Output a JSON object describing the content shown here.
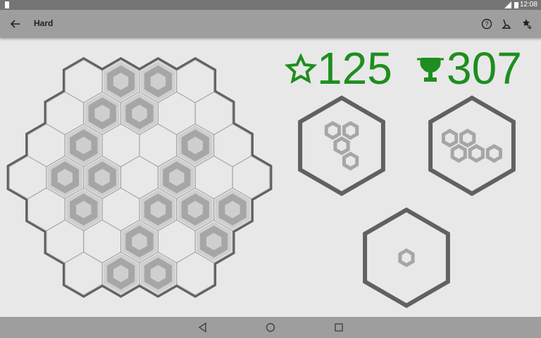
{
  "status_bar": {
    "time": "12:08"
  },
  "toolbar": {
    "title": "Hard",
    "back_icon": "arrow-back-icon",
    "actions": [
      "help-icon",
      "hint-icon",
      "leaderboard-icon"
    ]
  },
  "score": {
    "current": "125",
    "best": "307",
    "star_icon": "star-outline-icon",
    "trophy_icon": "trophy-icon"
  },
  "colors": {
    "accent": "#1e8e1e",
    "piece": "#a6a6a6",
    "board_frame": "#616161",
    "cell_line": "#9a9a9a",
    "background": "#e8e8e8"
  },
  "board": {
    "rows": [
      {
        "length": 4,
        "filled": [
          false,
          true,
          true,
          false
        ]
      },
      {
        "length": 5,
        "filled": [
          false,
          true,
          true,
          false,
          false
        ]
      },
      {
        "length": 6,
        "filled": [
          false,
          true,
          false,
          false,
          true,
          false
        ]
      },
      {
        "length": 7,
        "filled": [
          false,
          true,
          true,
          false,
          true,
          false,
          false
        ]
      },
      {
        "length": 6,
        "filled": [
          false,
          true,
          false,
          true,
          true,
          true
        ]
      },
      {
        "length": 5,
        "filled": [
          false,
          false,
          true,
          false,
          true
        ]
      },
      {
        "length": 4,
        "filled": [
          false,
          true,
          true,
          false
        ]
      }
    ]
  },
  "pieces": [
    {
      "name": "piece-1",
      "cells": [
        [
          0,
          0
        ],
        [
          0,
          1
        ],
        [
          1,
          0
        ],
        [
          2,
          0
        ]
      ]
    },
    {
      "name": "piece-2",
      "cells": [
        [
          0,
          0
        ],
        [
          0,
          1
        ],
        [
          1,
          0
        ],
        [
          1,
          1
        ],
        [
          1,
          2
        ]
      ]
    },
    {
      "name": "piece-3",
      "cells": [
        [
          0,
          0
        ]
      ]
    }
  ],
  "navigation": {
    "back": "nav-back-icon",
    "home": "nav-home-icon",
    "recents": "nav-recents-icon"
  }
}
